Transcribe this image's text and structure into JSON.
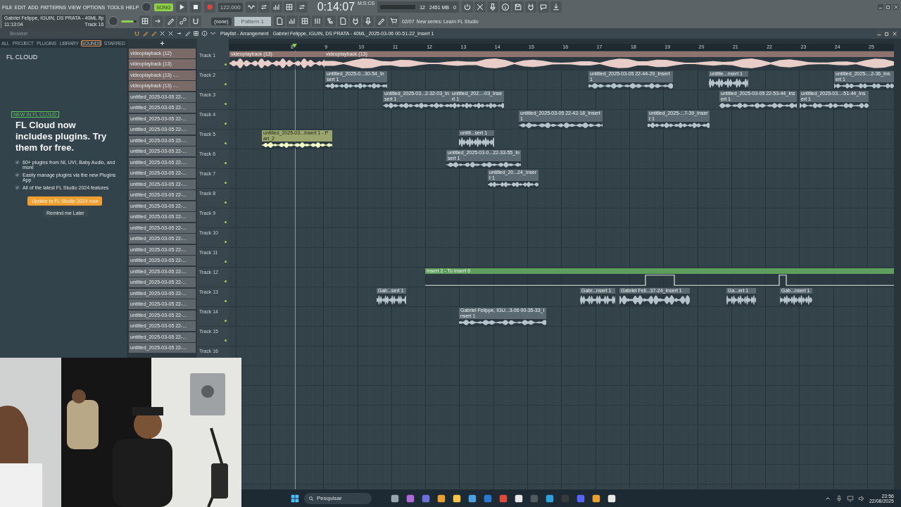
{
  "menu": [
    "FILE",
    "EDIT",
    "ADD",
    "PATTERNS",
    "VIEW",
    "OPTIONS",
    "TOOLS",
    "HELP"
  ],
  "project": {
    "file": "Gabriel Felippe, IGUIN, DS PRATA - 40ML.flp",
    "time": "11:13:04",
    "hint": "Track 16"
  },
  "transport": {
    "mode": "SONG",
    "tempo": "122.000",
    "song_time": "0:14:07",
    "time_unit": "M:S:CS"
  },
  "monitor": {
    "cpu": "12",
    "memory": "2451 MB",
    "polyphony": "0"
  },
  "master_volume": {
    "level": 0.8
  },
  "channel_selector": "(none)",
  "pattern_selector": "Pattern 1",
  "news": {
    "counter": "02/07",
    "text": "New series: Learn FL Studio"
  },
  "browser": {
    "title": "Browser",
    "tabs": [
      {
        "label": "ALL",
        "selected": false
      },
      {
        "label": "PROJECT",
        "selected": false
      },
      {
        "label": "PLUGINS",
        "selected": false
      },
      {
        "label": "LIBRARY",
        "selected": false
      },
      {
        "label": "SOUNDS",
        "selected": true
      },
      {
        "label": "STARRED",
        "selected": false
      }
    ]
  },
  "promo": {
    "heading": "FL CLOUD",
    "badge": "NEW IN FL CLOUD",
    "headline": "FL Cloud now includes plugins. Try them for free.",
    "bullets": [
      "60+ plugins from NI, UVI, Baby Audio, and more",
      "Easily manage plugins via the new Plugins App",
      "All of the latest FL Studio 2024 features"
    ],
    "primary_button": "Update to FL Studio 2024 now",
    "secondary_button": "Remind me Later"
  },
  "playlist": {
    "title": "Playlist - Arrangement",
    "path": "Gabriel Felippe, IGUIN, DS PRATA - 40ML_2025-03-06 00-51-22_Insert 1",
    "bars": [
      "8",
      "9",
      "10",
      "11",
      "12",
      "13",
      "14",
      "15",
      "16",
      "17",
      "18",
      "19",
      "20",
      "21",
      "22",
      "23",
      "24",
      "25"
    ],
    "clip_list": [
      "videoplayback (12)",
      "videoplayback (13)",
      "videoplayback (13) -...",
      "videoplayback (13) -...",
      "untitled_2025-03-05 22-...",
      "untitled_2025-03-05 22-...",
      "untitled_2025-03-05 22-...",
      "untitled_2025-03-05 22-...",
      "untitled_2025-03-05 22-...",
      "untitled_2025-03-05 22-...",
      "untitled_2025-03-05 22-...",
      "untitled_2025-03-05 22-...",
      "untitled_2025-03-05 22-...",
      "untitled_2025-03-05 22-...",
      "untitled_2025-03-05 22-...",
      "untitled_2025-03-05 22-...",
      "untitled_2025-03-05 22-...",
      "untitled_2025-03-05 22-...",
      "untitled_2025-03-05 22-...",
      "untitled_2025-03-05 22-...",
      "untitled_2025-03-05 22-...",
      "untitled_2025-03-05 22-...",
      "untitled_2025-03-05 22-...",
      "untitled_2025-03-05 22-...",
      "untitled_2025-03-05 22-...",
      "untitled_2025-03-05 22-...",
      "untitled_2025-03-05 22-...",
      "untitled_2025-03-05 22-..."
    ],
    "tracks": [
      {
        "name": "Track 1",
        "clips": [
          {
            "kind": "audio",
            "label": "videoplayback (13)",
            "color": "#8f736e"
          },
          {
            "kind": "audio",
            "label": "videoplayback (13)",
            "color": "#8f736e"
          }
        ]
      },
      {
        "name": "Track 2",
        "clips": [
          {
            "kind": "audio",
            "label": "untitled_2025-0...30-54_Insert 1",
            "color": "#5b6a72"
          },
          {
            "kind": "audio",
            "label": "untitled_2025-03-05 22-44-29_Insert 1",
            "color": "#5b6a72"
          },
          {
            "kind": "audio",
            "label": "untitle...nsert 1",
            "color": "#5b6a72"
          },
          {
            "kind": "audio",
            "label": "untitled_2025-...2-36_Insert 1",
            "color": "#5b6a72"
          }
        ]
      },
      {
        "name": "Track 3",
        "clips": [
          {
            "kind": "audio",
            "label": "untitled_2025-03...2-32-03_Insert 1",
            "color": "#5b6a72"
          },
          {
            "kind": "audio",
            "label": "untitled_202...-03_Insert 1",
            "color": "#5b6a72"
          },
          {
            "kind": "audio",
            "label": "untitled_2025-03-05 22-53-44_Insert 1",
            "color": "#5b6a72"
          },
          {
            "kind": "audio",
            "label": "untitled_2025-03...-51-44_Insert 1",
            "color": "#5b6a72"
          }
        ]
      },
      {
        "name": "Track 4",
        "clips": [
          {
            "kind": "audio",
            "label": "untitled_2025-03-05 22-42-18_Insert 1",
            "color": "#5b6a72"
          },
          {
            "kind": "audio",
            "label": "untitled_2025-...7-39_Insert 1",
            "color": "#5b6a72"
          }
        ]
      },
      {
        "name": "Track 5",
        "clips": [
          {
            "kind": "audio",
            "label": "untitled_2025-03...Insert 1 - Part_2",
            "color": "#9aa56e"
          },
          {
            "kind": "audio",
            "label": "untitl...sert 1",
            "color": "#5b6a72"
          }
        ]
      },
      {
        "name": "Track 6",
        "clips": [
          {
            "kind": "audio",
            "label": "untitled_2025-03-0...22-33-55_Insert 1",
            "color": "#5b6a72"
          }
        ]
      },
      {
        "name": "Track 7",
        "clips": [
          {
            "kind": "audio",
            "label": "untitled_20...24_Insert 1",
            "color": "#5b6a72"
          }
        ]
      },
      {
        "name": "Track 8"
      },
      {
        "name": "Track 9"
      },
      {
        "name": "Track 10"
      },
      {
        "name": "Track 11"
      },
      {
        "name": "Track 12",
        "clips": [
          {
            "kind": "automation",
            "label": "Insert 2 - To Insert 6",
            "color": "#5e9e5c"
          }
        ]
      },
      {
        "name": "Track 13",
        "clips": [
          {
            "kind": "audio",
            "label": "Gab...sert 1",
            "color": "#5b6a72"
          },
          {
            "kind": "audio",
            "label": "Gabr...nsert 1",
            "color": "#5b6a72"
          },
          {
            "kind": "audio",
            "label": "Gabriel Feli...37-24_Insert 1",
            "color": "#5b6a72"
          },
          {
            "kind": "audio",
            "label": "Ga...ert 1",
            "color": "#5b6a72"
          },
          {
            "kind": "audio",
            "label": "Gab...nsert 1",
            "color": "#5b6a72"
          }
        ]
      },
      {
        "name": "Track 14",
        "clips": [
          {
            "kind": "audio",
            "label": "Gabriel Felippe, IGU...3-06 00-35-33_Insert 1",
            "color": "#5b6a72"
          }
        ]
      },
      {
        "name": "Track 15"
      },
      {
        "name": "Track 16"
      }
    ]
  },
  "taskbar": {
    "search": {
      "placeholder": "Pesquisar"
    },
    "time": "23:56",
    "date": "22/08/2025"
  }
}
